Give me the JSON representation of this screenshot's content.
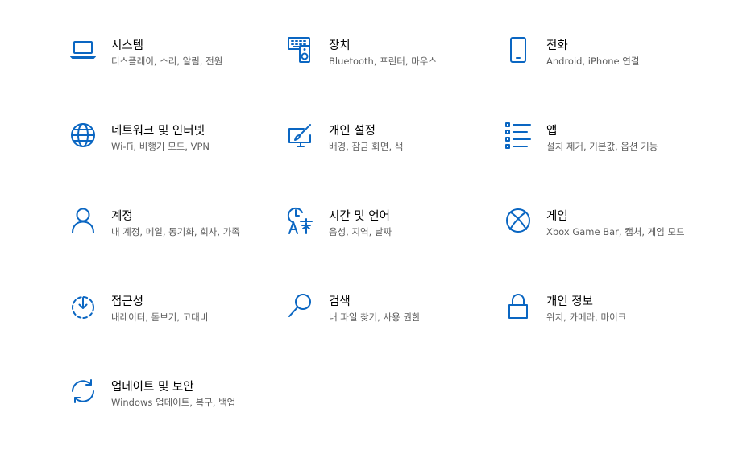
{
  "colors": {
    "accent": "#0a66c2",
    "title_text": "#000000",
    "description_text": "#5c5c5c",
    "background": "#ffffff"
  },
  "tiles": [
    {
      "icon": "laptop-icon",
      "title": "시스템",
      "description": "디스플레이, 소리, 알림, 전원"
    },
    {
      "icon": "keyboard-speaker-icon",
      "title": "장치",
      "description": "Bluetooth, 프린터, 마우스"
    },
    {
      "icon": "phone-icon",
      "title": "전화",
      "description": "Android, iPhone 연결"
    },
    {
      "icon": "globe-icon",
      "title": "네트워크 및 인터넷",
      "description": "Wi-Fi, 비행기 모드, VPN"
    },
    {
      "icon": "personalization-pen-icon",
      "title": "개인 설정",
      "description": "배경, 잠금 화면, 색"
    },
    {
      "icon": "apps-list-icon",
      "title": "앱",
      "description": "설치 제거, 기본값, 옵션 기능"
    },
    {
      "icon": "person-icon",
      "title": "계정",
      "description": "내 계정, 메일, 동기화, 회사, 가족"
    },
    {
      "icon": "time-language-icon",
      "title": "시간 및 언어",
      "description": "음성, 지역, 날짜"
    },
    {
      "icon": "xbox-icon",
      "title": "게임",
      "description": "Xbox Game Bar, 캡처, 게임 모드"
    },
    {
      "icon": "accessibility-timer-icon",
      "title": "접근성",
      "description": "내레이터, 돋보기, 고대비"
    },
    {
      "icon": "search-icon",
      "title": "검색",
      "description": "내 파일 찾기, 사용 권한"
    },
    {
      "icon": "lock-icon",
      "title": "개인 정보",
      "description": "위치, 카메라, 마이크"
    },
    {
      "icon": "sync-icon",
      "title": "업데이트 및 보안",
      "description": "Windows 업데이트, 복구, 백업"
    }
  ]
}
